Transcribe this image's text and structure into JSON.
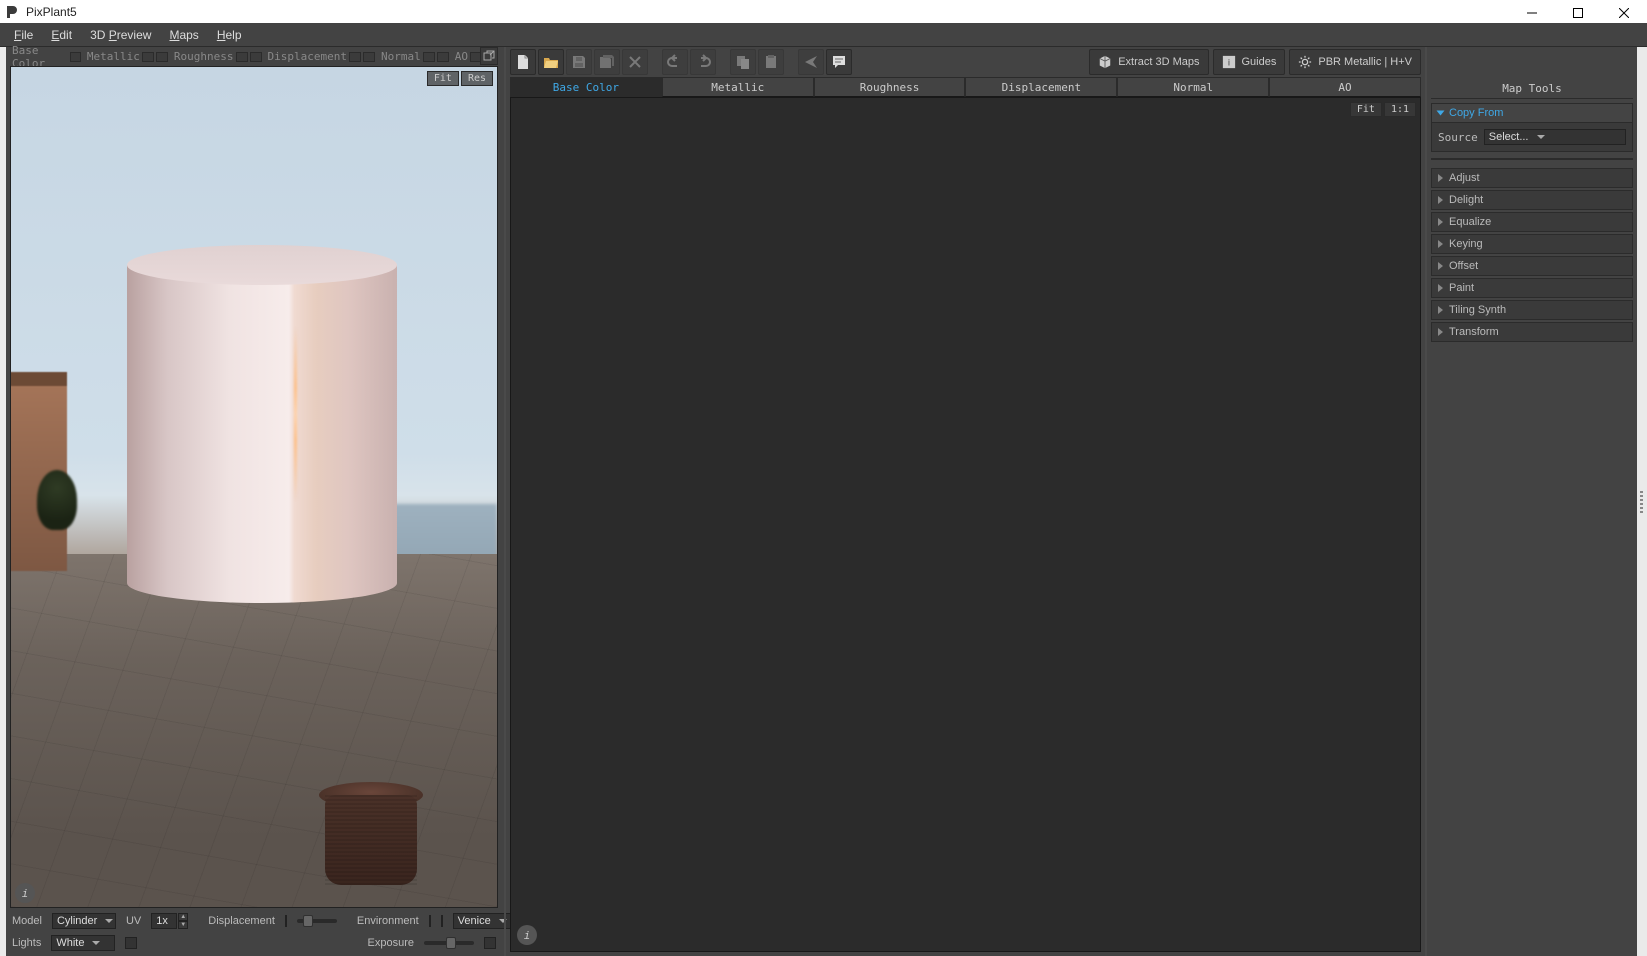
{
  "window": {
    "title": "PixPlant5"
  },
  "menu": {
    "file": "File",
    "edit": "Edit",
    "preview": "3D Preview",
    "maps": "Maps",
    "help": "Help"
  },
  "map_labels": {
    "base_color": "Base Color",
    "metallic": "Metallic",
    "roughness": "Roughness",
    "displacement": "Displacement",
    "normal": "Normal",
    "ao": "AO"
  },
  "viewport": {
    "fit": "Fit",
    "res": "Res"
  },
  "bottom": {
    "model_label": "Model",
    "model_value": "Cylinder",
    "uv_label": "UV",
    "uv_value": "1x",
    "displacement_label": "Displacement",
    "environment_label": "Environment",
    "environment_value": "Venice",
    "lights_label": "Lights",
    "lights_value": "White",
    "exposure_label": "Exposure"
  },
  "toolbar": {
    "extract": "Extract 3D Maps",
    "guides": "Guides",
    "workflow": "PBR Metallic | H+V"
  },
  "tabs": {
    "base_color": "Base Color",
    "metallic": "Metallic",
    "roughness": "Roughness",
    "displacement": "Displacement",
    "normal": "Normal",
    "ao": "AO"
  },
  "canvas": {
    "fit": "Fit",
    "one": "1:1"
  },
  "right": {
    "title": "Map Tools",
    "copy_from": "Copy From",
    "source_label": "Source",
    "source_value": "Select...",
    "sections": {
      "adjust": "Adjust",
      "delight": "Delight",
      "equalize": "Equalize",
      "keying": "Keying",
      "offset": "Offset",
      "paint": "Paint",
      "tiling": "Tiling Synth",
      "transform": "Transform"
    }
  }
}
